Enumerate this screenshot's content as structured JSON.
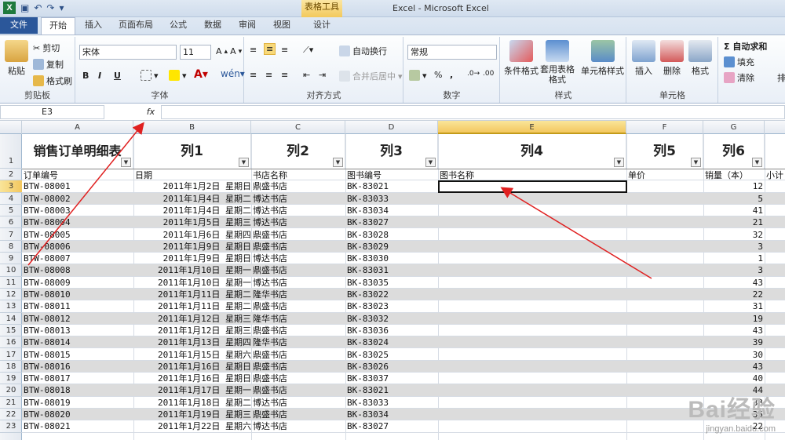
{
  "window": {
    "title": "Excel  -  Microsoft Excel",
    "tool_tab": "表格工具"
  },
  "tabs": [
    "文件",
    "开始",
    "插入",
    "页面布局",
    "公式",
    "数据",
    "审阅",
    "视图",
    "设计"
  ],
  "ribbon": {
    "clipboard": {
      "paste": "粘贴",
      "cut": "剪切",
      "copy": "复制",
      "format_painter": "格式刷",
      "label": "剪贴板"
    },
    "font": {
      "name": "宋体",
      "size": "11",
      "bold": "B",
      "italic": "I",
      "underline": "U",
      "label": "字体"
    },
    "alignment": {
      "wrap": "自动换行",
      "merge": "合并后居中",
      "label": "对齐方式"
    },
    "number": {
      "format": "常规",
      "percent": "%",
      "comma": ",",
      "label": "数字"
    },
    "styles": {
      "conditional": "条件格式",
      "table": "套用表格格式",
      "cell": "单元格样式",
      "label": "样式"
    },
    "cells": {
      "insert": "插入",
      "delete": "删除",
      "format": "格式",
      "label": "单元格"
    },
    "editing": {
      "autosum": "Σ 自动求和",
      "fill": "填充",
      "clear": "清除",
      "sort": "排"
    }
  },
  "formula_bar": {
    "name_box": "E3",
    "fx": "fx",
    "value": ""
  },
  "columns": [
    "A",
    "B",
    "C",
    "D",
    "E",
    "F",
    "G"
  ],
  "selected_column": "E",
  "row_numbers": [
    "1",
    "2",
    "3",
    "4",
    "5",
    "6",
    "7",
    "8",
    "9",
    "10",
    "11",
    "12",
    "13",
    "14",
    "15",
    "16",
    "17",
    "18",
    "19",
    "20",
    "21",
    "22",
    "23"
  ],
  "table": {
    "title": "销售订单明细表",
    "col_titles": [
      "列1",
      "列2",
      "列3",
      "列4",
      "列5",
      "列6"
    ],
    "headers": [
      "订单编号",
      "日期",
      "书店名称",
      "图书编号",
      "图书名称",
      "单价",
      "销量（本）",
      "小计"
    ],
    "rows": [
      [
        "BTW-08001",
        "2011年1月2日  星期日",
        "鼎盛书店",
        "BK-83021",
        "",
        "",
        "12"
      ],
      [
        "BTW-08002",
        "2011年1月4日  星期二",
        "博达书店",
        "BK-83033",
        "",
        "",
        "5"
      ],
      [
        "BTW-08003",
        "2011年1月4日  星期二",
        "博达书店",
        "BK-83034",
        "",
        "",
        "41"
      ],
      [
        "BTW-08004",
        "2011年1月5日  星期三",
        "博达书店",
        "BK-83027",
        "",
        "",
        "21"
      ],
      [
        "BTW-08005",
        "2011年1月6日  星期四",
        "鼎盛书店",
        "BK-83028",
        "",
        "",
        "32"
      ],
      [
        "BTW-08006",
        "2011年1月9日  星期日",
        "鼎盛书店",
        "BK-83029",
        "",
        "",
        "3"
      ],
      [
        "BTW-08007",
        "2011年1月9日  星期日",
        "博达书店",
        "BK-83030",
        "",
        "",
        "1"
      ],
      [
        "BTW-08008",
        "2011年1月10日  星期一",
        "鼎盛书店",
        "BK-83031",
        "",
        "",
        "3"
      ],
      [
        "BTW-08009",
        "2011年1月10日  星期一",
        "博达书店",
        "BK-83035",
        "",
        "",
        "43"
      ],
      [
        "BTW-08010",
        "2011年1月11日  星期二",
        "隆华书店",
        "BK-83022",
        "",
        "",
        "22"
      ],
      [
        "BTW-08011",
        "2011年1月11日  星期二",
        "鼎盛书店",
        "BK-83023",
        "",
        "",
        "31"
      ],
      [
        "BTW-08012",
        "2011年1月12日  星期三",
        "隆华书店",
        "BK-83032",
        "",
        "",
        "19"
      ],
      [
        "BTW-08013",
        "2011年1月12日  星期三",
        "鼎盛书店",
        "BK-83036",
        "",
        "",
        "43"
      ],
      [
        "BTW-08014",
        "2011年1月13日  星期四",
        "隆华书店",
        "BK-83024",
        "",
        "",
        "39"
      ],
      [
        "BTW-08015",
        "2011年1月15日  星期六",
        "鼎盛书店",
        "BK-83025",
        "",
        "",
        "30"
      ],
      [
        "BTW-08016",
        "2011年1月16日  星期日",
        "鼎盛书店",
        "BK-83026",
        "",
        "",
        "43"
      ],
      [
        "BTW-08017",
        "2011年1月16日  星期日",
        "鼎盛书店",
        "BK-83037",
        "",
        "",
        "40"
      ],
      [
        "BTW-08018",
        "2011年1月17日  星期一",
        "鼎盛书店",
        "BK-83021",
        "",
        "",
        "44"
      ],
      [
        "BTW-08019",
        "2011年1月18日  星期二",
        "博达书店",
        "BK-83033",
        "",
        "",
        "33"
      ],
      [
        "BTW-08020",
        "2011年1月19日  星期三",
        "鼎盛书店",
        "BK-83034",
        "",
        "",
        "35"
      ],
      [
        "BTW-08021",
        "2011年1月22日  星期六",
        "博达书店",
        "BK-83027",
        "",
        "",
        "22"
      ]
    ]
  },
  "watermark": {
    "brand": "Bai经验",
    "url": "jingyan.baidu.com"
  },
  "colors": {
    "file_tab": "#2b579a",
    "tool_tab": "#f3c95c",
    "band": "#dcdcdc",
    "arrow": "#e02020"
  }
}
